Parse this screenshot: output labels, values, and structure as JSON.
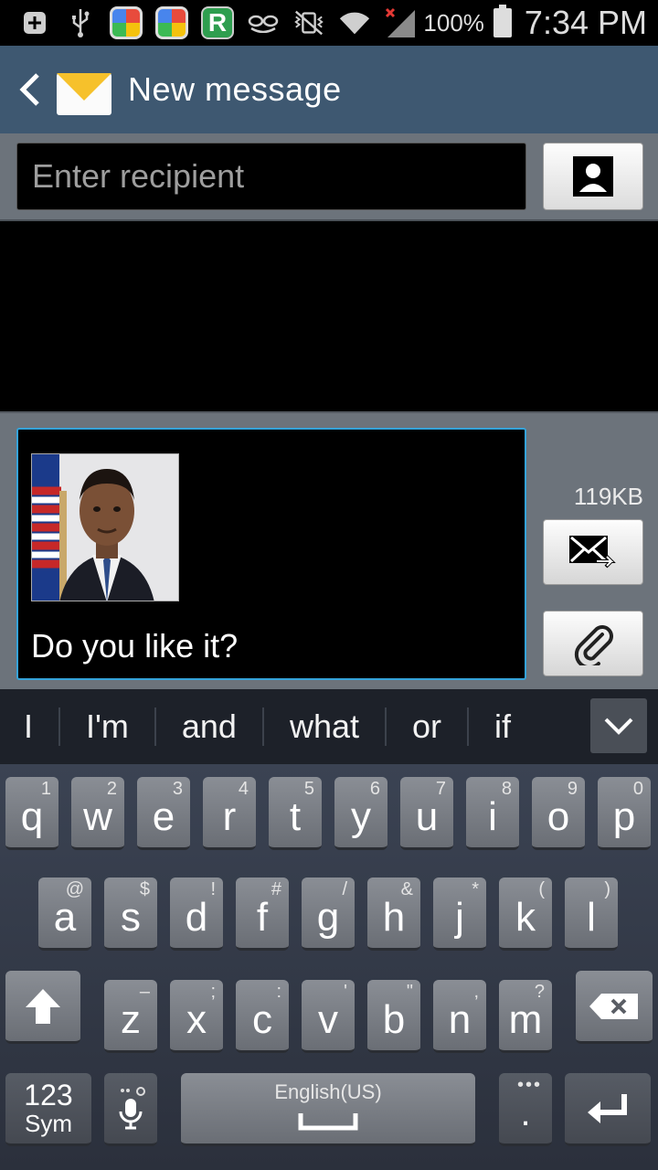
{
  "status_bar": {
    "icons": [
      "add-notification-icon",
      "usb-icon",
      "app-multicolor-icon",
      "app-multicolor-icon",
      "app-r-icon",
      "mask-icon",
      "vibrate-mute-icon",
      "wifi-icon",
      "signal-no-service-icon",
      "battery-icon"
    ],
    "battery_pct": "100%",
    "time": "7:34 PM"
  },
  "action_bar": {
    "title": "New message"
  },
  "recipient": {
    "placeholder": "Enter recipient"
  },
  "compose": {
    "message": "Do you like it?",
    "size": "119KB"
  },
  "suggestions": [
    "I",
    "I'm",
    "and",
    "what",
    "or",
    "if"
  ],
  "keyboard": {
    "row1": [
      {
        "k": "q",
        "s": "1"
      },
      {
        "k": "w",
        "s": "2"
      },
      {
        "k": "e",
        "s": "3"
      },
      {
        "k": "r",
        "s": "4"
      },
      {
        "k": "t",
        "s": "5"
      },
      {
        "k": "y",
        "s": "6"
      },
      {
        "k": "u",
        "s": "7"
      },
      {
        "k": "i",
        "s": "8"
      },
      {
        "k": "o",
        "s": "9"
      },
      {
        "k": "p",
        "s": "0"
      }
    ],
    "row2": [
      {
        "k": "a",
        "s": "@"
      },
      {
        "k": "s",
        "s": "$"
      },
      {
        "k": "d",
        "s": "!"
      },
      {
        "k": "f",
        "s": "#"
      },
      {
        "k": "g",
        "s": "/"
      },
      {
        "k": "h",
        "s": "&"
      },
      {
        "k": "j",
        "s": "*"
      },
      {
        "k": "k",
        "s": "("
      },
      {
        "k": "l",
        "s": ")"
      }
    ],
    "row3": [
      {
        "k": "z",
        "s": "–"
      },
      {
        "k": "x",
        "s": ";"
      },
      {
        "k": "c",
        "s": ":"
      },
      {
        "k": "v",
        "s": "'"
      },
      {
        "k": "b",
        "s": "\""
      },
      {
        "k": "n",
        "s": ","
      },
      {
        "k": "m",
        "s": "?"
      }
    ],
    "sym_label_1": "123",
    "sym_label_2": "Sym",
    "space_label": "English(US)",
    "period": "."
  },
  "colors": {
    "action_bar": "#3e5871",
    "panel": "#6c737b",
    "compose_border": "#35a3d9",
    "keyboard_bg": "#2b303c"
  }
}
